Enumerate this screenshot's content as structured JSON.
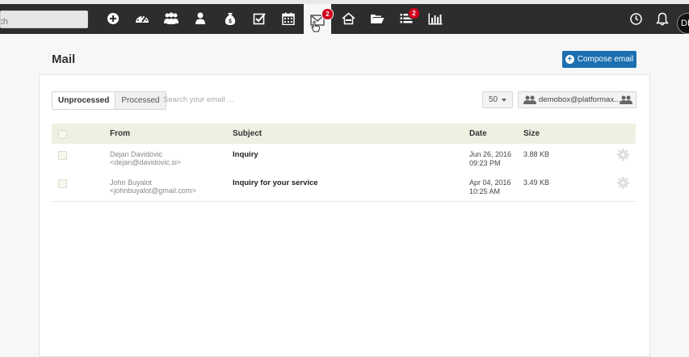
{
  "nav": {
    "search_placeholder": "Search",
    "icons": [
      {
        "name": "add-icon"
      },
      {
        "name": "dashboard-icon"
      },
      {
        "name": "people-icon"
      },
      {
        "name": "person-icon"
      },
      {
        "name": "money-bag-icon"
      },
      {
        "name": "tasks-icon"
      },
      {
        "name": "calendar-icon"
      },
      {
        "name": "mail-icon",
        "badge": "2",
        "active": true
      },
      {
        "name": "properties-icon"
      },
      {
        "name": "folder-icon"
      },
      {
        "name": "list-icon",
        "badge": "2"
      },
      {
        "name": "reports-icon"
      },
      {
        "name": "clock-icon"
      },
      {
        "name": "bell-icon"
      }
    ],
    "avatar_initials": "DD"
  },
  "page": {
    "title": "Mail",
    "compose_label": "Compose email"
  },
  "toolbar": {
    "tab_unprocessed": "Unprocessed",
    "tab_processed": "Processed",
    "search_placeholder": "Search your email ...",
    "per_page": "50",
    "mailbox": "demobox@platformax...."
  },
  "table": {
    "headers": {
      "from": "From",
      "subject": "Subject",
      "date": "Date",
      "size": "Size"
    },
    "rows": [
      {
        "from_name": "Dejan Davidovic",
        "from_email": "<dejan@davidovic.si>",
        "subject": "Inquiry",
        "date": "Jun 26, 2016",
        "time": "09:23 PM",
        "size": "3.88 KB"
      },
      {
        "from_name": "John Buyalot",
        "from_email": "<johnbuyalot@gmail.com>",
        "subject": "Inquiry for your service",
        "date": "Apr 04, 2016",
        "time": "10:25 AM",
        "size": "3.49 KB"
      }
    ]
  },
  "colors": {
    "navbar": "#2d2d2d",
    "primary": "#1c6fb0",
    "badge": "#d0021b",
    "table_header": "#efefe2"
  }
}
